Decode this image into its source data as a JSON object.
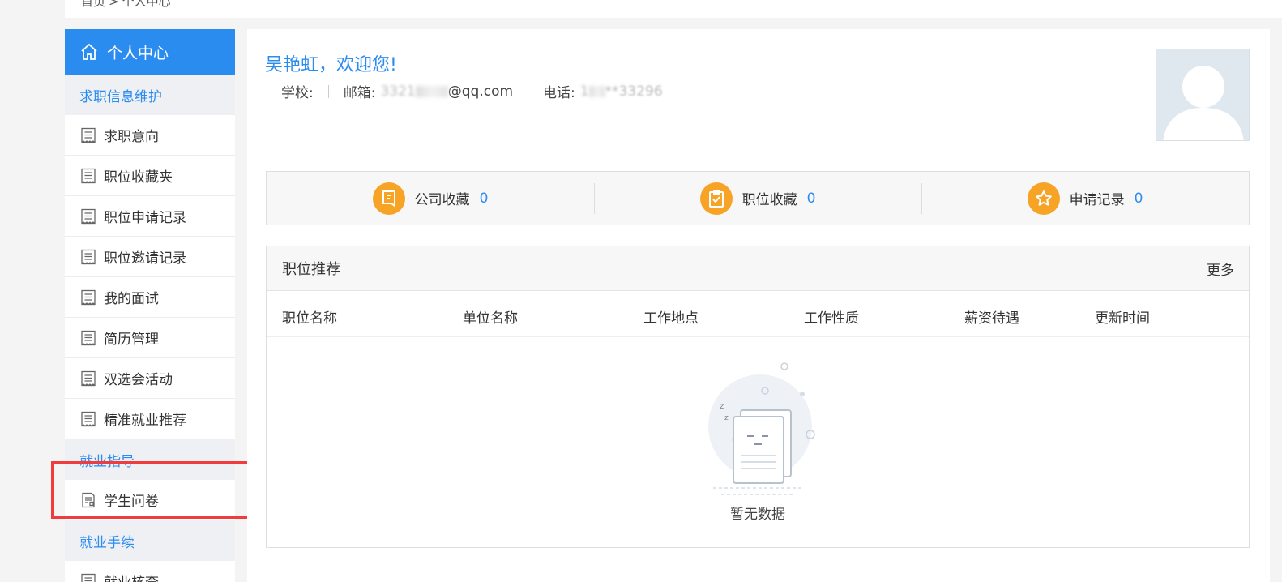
{
  "breadcrumb": {
    "home": "首页",
    "separator": ">",
    "current": "个人中心"
  },
  "sidebar": {
    "title": "个人中心",
    "section1": "求职信息维护",
    "items1": [
      "求职意向",
      "职位收藏夹",
      "职位申请记录",
      "职位邀请记录",
      "我的面试",
      "简历管理",
      "双选会活动",
      "精准就业推荐"
    ],
    "section2": "就业指导",
    "items2": [
      "学生问卷"
    ],
    "section3": "就业手续",
    "items3": [
      "就业核查"
    ]
  },
  "profile": {
    "welcome": "吴艳虹，欢迎您!",
    "school_label": "学校:",
    "email_label": "邮箱:",
    "email_start": "3321",
    "email_end": "@qq.com",
    "phone_label": "电话:",
    "phone_start": "1",
    "phone_end": "**33296"
  },
  "stats": [
    {
      "label": "公司收藏",
      "count": "0",
      "icon": "company-collect-icon"
    },
    {
      "label": "职位收藏",
      "count": "0",
      "icon": "job-collect-icon"
    },
    {
      "label": "申请记录",
      "count": "0",
      "icon": "star-icon"
    }
  ],
  "recommend": {
    "title": "职位推荐",
    "more": "更多",
    "columns": [
      "职位名称",
      "单位名称",
      "工作地点",
      "工作性质",
      "薪资待遇",
      "更新时间"
    ],
    "empty_text": "暂无数据"
  },
  "colors": {
    "accent": "#2b8cf0",
    "stat_icon": "#f7a325",
    "highlight": "#f03c3c"
  }
}
